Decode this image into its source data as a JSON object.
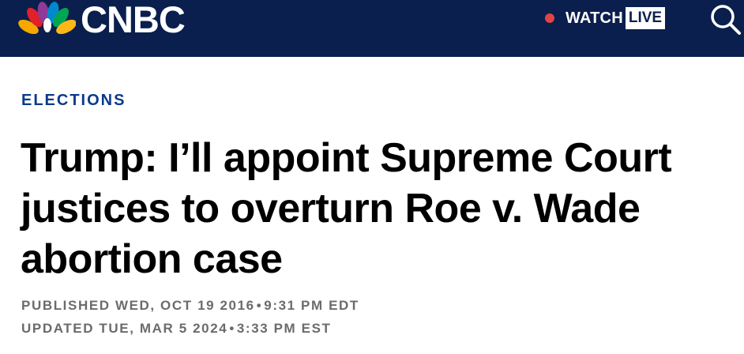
{
  "header": {
    "brand": "CNBC",
    "watch_label": "WATCH",
    "live_label": "LIVE",
    "colors": {
      "navbar_bg": "#0a1f4d",
      "live_dot": "#e04545"
    },
    "icons": {
      "logo": "nbc-peacock-icon",
      "search": "search-icon"
    }
  },
  "article": {
    "section": "ELECTIONS",
    "headline": "Trump: I’ll appoint Supreme Court justices to overturn Roe v. Wade abortion case",
    "published": {
      "label": "PUBLISHED WED, OCT 19 2016",
      "separator": "•",
      "time": "9:31 PM EDT"
    },
    "updated": {
      "label": "UPDATED TUE, MAR 5 2024",
      "separator": "•",
      "time": "3:33 PM EST"
    }
  }
}
